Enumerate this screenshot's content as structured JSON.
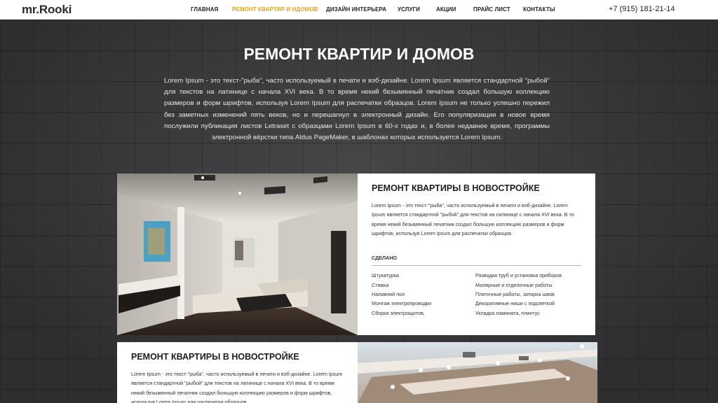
{
  "header": {
    "logo_prefix": "mr.",
    "logo_main": "Rooki",
    "nav": [
      {
        "label": "ГЛАВНАЯ",
        "active": false
      },
      {
        "label": "РЕМОНТ КВАРТИР И ИДОМОВ",
        "active": true
      },
      {
        "label": "ДИЗАЙН ИНТЕРЬЕРА",
        "active": false
      },
      {
        "label": "УСЛУГИ",
        "active": false
      },
      {
        "label": "АКЦИИ",
        "active": false
      },
      {
        "label": "ПРАЙС ЛИСТ",
        "active": false
      },
      {
        "label": "КОНТАКТЫ",
        "active": false
      }
    ],
    "phone": "+7 (915) 181-21-14"
  },
  "intro": {
    "title": "РЕМОНТ КВАРТИР И ДОМОВ",
    "text": "Lorem Ipsum - это текст-\"рыба\", часто используемый в печати и вэб-дизайне. Lorem Ipsum является стандартной \"рыбой\" для текстов на латинице с начала XVI века. В то время некий безымянный печатник создал большую коллекцию размеров и форм шрифтов, используя Lorem Ipsum для распечатки образцов. Lorem Ipsum не только успешно пережил без заметных изменений пять веков, но и перешагнул в электронный дизайн. Его популяризации в новое время послужили публикация листов Letraset с образцами Lorem Ipsum в 60-х годах и, в более недавнее время, программы электронной вёрстки типа Aldus PageMaker, в шаблонах которых используется Lorem Ipsum."
  },
  "cards": [
    {
      "title": "РЕМОНТ КВАРТИРЫ В НОВОСТРОЙКЕ",
      "description": "Lorem Ipsum - это текст-\"рыба\", часто используемый в печати и вэб-дизайне. Lorem Ipsum является стандартной \"рыбой\" для текстов на латинице с начала XVI века. В то время некий безымянный печатник создал большую коллекцию размеров и форм шрифтов, используя Lorem Ipsum для распечатки образцов.",
      "done_label": "СДЕЛАНО",
      "done_items": [
        "Штукатурка",
        "Разводка труб и установка приборов",
        "Стяжка",
        "Малярные и отделочные работы",
        "Наливной пол",
        "Плиточные работы, затирка швов",
        "Монтаж электропроводки",
        "Декоративные ниши с подсветкой",
        "Сборка электрощитов,",
        "Укладка ламината, плинтус"
      ]
    },
    {
      "title": "РЕМОНТ КВАРТИРЫ В НОВОСТРОЙКЕ",
      "description": "Lorem Ipsum - это текст-\"рыба\", часто используемый в печати и вэб-дизайне. Lorem Ipsum является стандартной \"рыбой\" для текстов на латинице с начала XVI века. В то время некий безымянный печатник создал большую коллекцию размеров и форм шрифтов, используя Lorem Ipsum для распечатки образцов."
    }
  ],
  "colors": {
    "accent": "#f0a020",
    "background": "#3d3d40",
    "card": "#ffffff"
  }
}
